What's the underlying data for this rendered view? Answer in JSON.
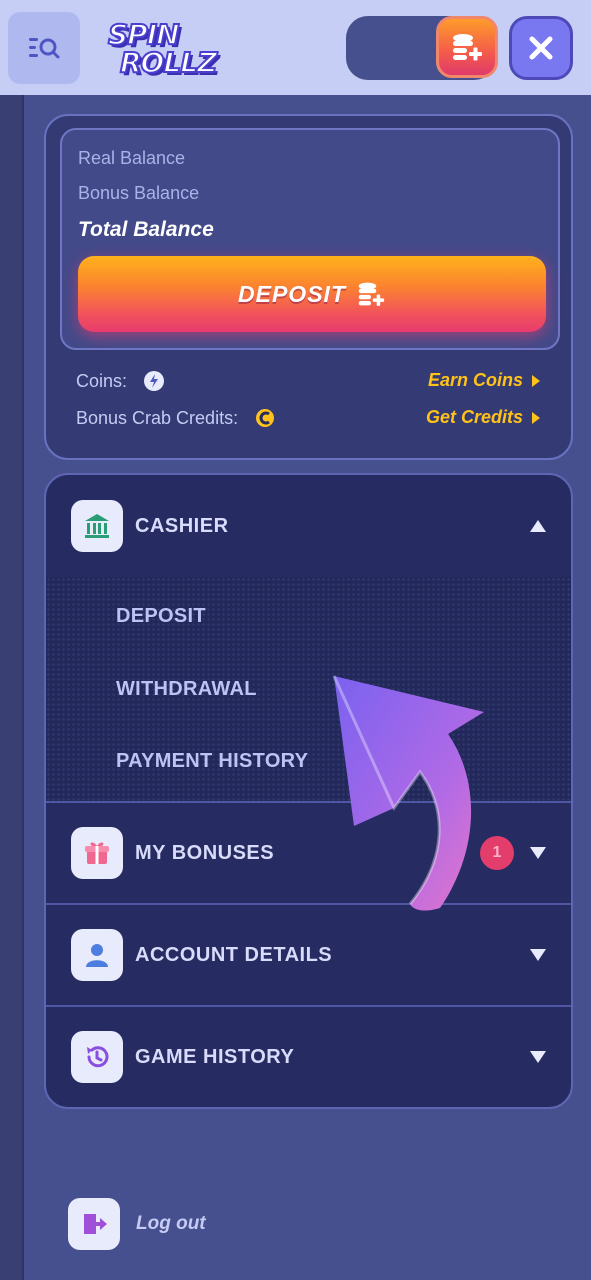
{
  "header": {
    "logo_line1": "SPIN",
    "logo_line2": "ROLLZ",
    "icons": {
      "search": "menu-search-icon",
      "coin_add": "coin-stack-plus-icon",
      "close": "close-icon"
    }
  },
  "balance": {
    "real_label": "Real Balance",
    "bonus_label": "Bonus Balance",
    "total_label": "Total Balance",
    "deposit_label": "DEPOSIT",
    "coins_label": "Coins:",
    "earn_coins_label": "Earn Coins",
    "credits_label": "Bonus Crab Credits:",
    "get_credits_label": "Get Credits"
  },
  "menu": {
    "cashier": {
      "label": "CASHIER",
      "items": [
        "DEPOSIT",
        "WITHDRAWAL",
        "PAYMENT HISTORY"
      ]
    },
    "bonuses": {
      "label": "MY BONUSES",
      "badge": "1"
    },
    "account": {
      "label": "ACCOUNT DETAILS"
    },
    "history": {
      "label": "GAME HISTORY"
    }
  },
  "logout_label": "Log out",
  "colors": {
    "accent_orange": "#fb8330",
    "accent_pink": "#e73b6e",
    "link_yellow": "#ffc21a",
    "panel": "#262c62"
  }
}
